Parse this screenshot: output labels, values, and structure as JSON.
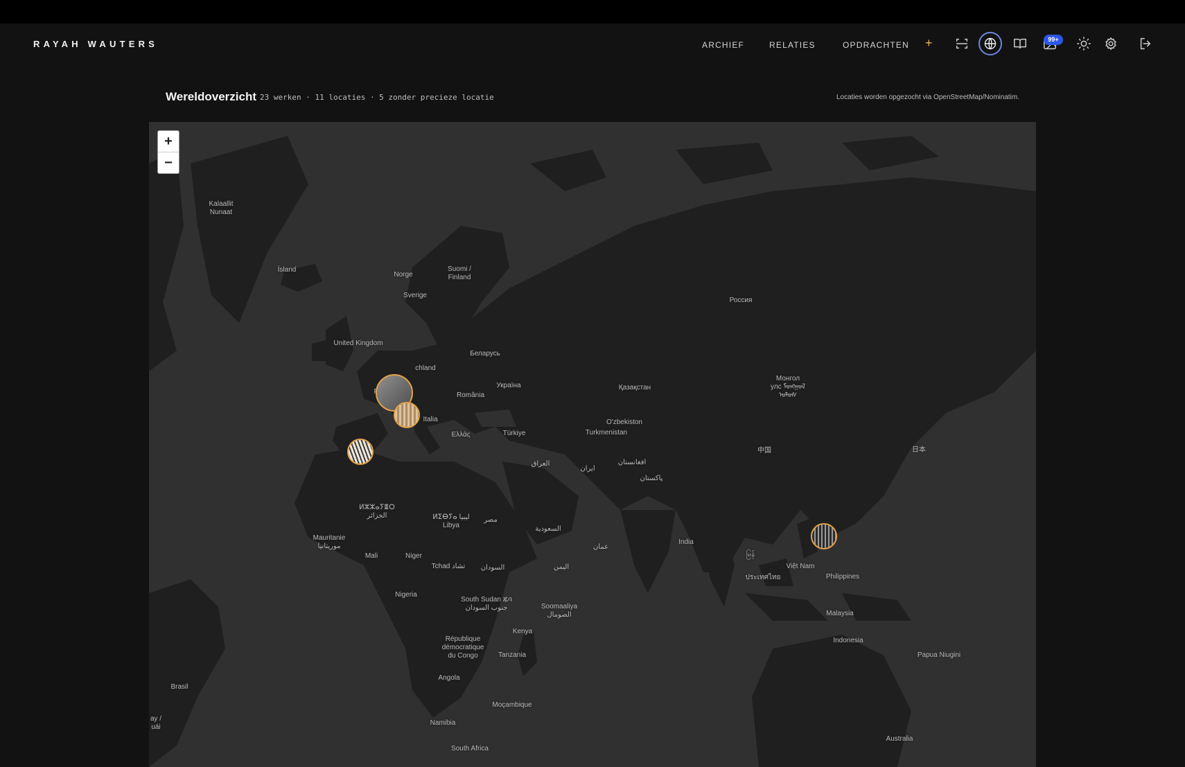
{
  "header": {
    "brand": "RAYAH WAUTERS",
    "nav": [
      {
        "label": "ARCHIEF"
      },
      {
        "label": "RELATIES"
      },
      {
        "label": "OPDRACHTEN"
      }
    ],
    "add_label": "+",
    "icons": [
      "scan-icon",
      "globe-icon",
      "book-icon",
      "image-icon",
      "sun-icon",
      "gear-icon",
      "logout-icon"
    ],
    "notification_badge": "99+",
    "accent": "#e6b15a",
    "active_ring": "#6e86e0",
    "badge_color": "#2b57e6"
  },
  "page": {
    "title": "Wereldoverzicht",
    "stats": "23 werken · 11 locaties · 5 zonder precieze locatie",
    "source_note": "Locaties worden opgezocht via OpenStreetMap/Nominatim."
  },
  "map": {
    "zoom_in": "+",
    "zoom_out": "−",
    "labels": [
      {
        "text": "Kalaallit\nNunaat"
      },
      {
        "text": "Ísland"
      },
      {
        "text": "Norge"
      },
      {
        "text": "Suomi /\nFinland"
      },
      {
        "text": "Sverige"
      },
      {
        "text": "Россия"
      },
      {
        "text": "United Kingdom"
      },
      {
        "text": "Беларусь"
      },
      {
        "text": "chland"
      },
      {
        "text": "France"
      },
      {
        "text": "Україна"
      },
      {
        "text": "România"
      },
      {
        "text": "Қазақстан"
      },
      {
        "text": "Монгол\nулс ᠮᠣᠩᠭᠣᠯ\nᠤᠯᠤᠰ"
      },
      {
        "text": "Italia"
      },
      {
        "text": "Ελλάς"
      },
      {
        "text": "Türkiye"
      },
      {
        "text": "O'zbekiston"
      },
      {
        "text": "Turkmenistan"
      },
      {
        "text": "中国"
      },
      {
        "text": "日本"
      },
      {
        "text": "العراق"
      },
      {
        "text": "ایران"
      },
      {
        "text": "افغانستان"
      },
      {
        "text": "پاکستان"
      },
      {
        "text": "ⵍⵣⵣⴰⵢⴻⵔ\nالجزائر"
      },
      {
        "text": "ⵍⵉⴱⵢⴰ ليبيا\nLibya"
      },
      {
        "text": "مصر"
      },
      {
        "text": "السعودية"
      },
      {
        "text": "Mauritanie\nموريتانيا"
      },
      {
        "text": "Mali"
      },
      {
        "text": "Niger"
      },
      {
        "text": "Tchad تشاد"
      },
      {
        "text": "السودان"
      },
      {
        "text": "عمان"
      },
      {
        "text": "India"
      },
      {
        "text": "မြန်"
      },
      {
        "text": "Việt Nam"
      },
      {
        "text": "ประเทศไทย"
      },
      {
        "text": "Philippines"
      },
      {
        "text": "اليمن"
      },
      {
        "text": "Nigeria"
      },
      {
        "text": "South Sudan ጁባ\nجنوب السودان"
      },
      {
        "text": "Soomaaliya\nالصومال"
      },
      {
        "text": "Kenya"
      },
      {
        "text": "Malaysia"
      },
      {
        "text": "Indonesia"
      },
      {
        "text": "République\ndémocratique\ndu Congo"
      },
      {
        "text": "Tanzania"
      },
      {
        "text": "Papua Niugini"
      },
      {
        "text": "Angola"
      },
      {
        "text": "Brasil"
      },
      {
        "text": "Moçambique"
      },
      {
        "text": "Namibia"
      },
      {
        "text": "Australia"
      },
      {
        "text": "South Africa"
      },
      {
        "text": "ay /\nuái"
      }
    ],
    "markers": [
      {
        "name": "marker-belgium-cluster"
      },
      {
        "name": "marker-central-europe"
      },
      {
        "name": "marker-iberia"
      },
      {
        "name": "marker-south-china"
      }
    ]
  }
}
